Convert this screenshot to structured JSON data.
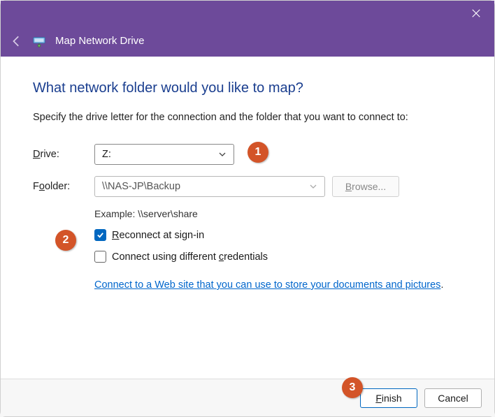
{
  "window": {
    "title": "Map Network Drive"
  },
  "heading": "What network folder would you like to map?",
  "instruction": "Specify the drive letter for the connection and the folder that you want to connect to:",
  "labels": {
    "drive": "rive:",
    "folder": "older:"
  },
  "drive_value": "Z:",
  "folder_value": "\\\\NAS-JP\\Backup",
  "browse_label": "rowse...",
  "example": "Example: \\\\server\\share",
  "checks": {
    "reconnect": "econnect at sign-in",
    "credentials": "Connect using different ",
    "credentials_tail": "redentials"
  },
  "link_text": "Connect to a Web site that you can use to store your documents and pictures",
  "link_period": ".",
  "buttons": {
    "finish": "inish",
    "cancel": "Cancel"
  },
  "badges": {
    "b1": "1",
    "b2": "2",
    "b3": "3"
  }
}
